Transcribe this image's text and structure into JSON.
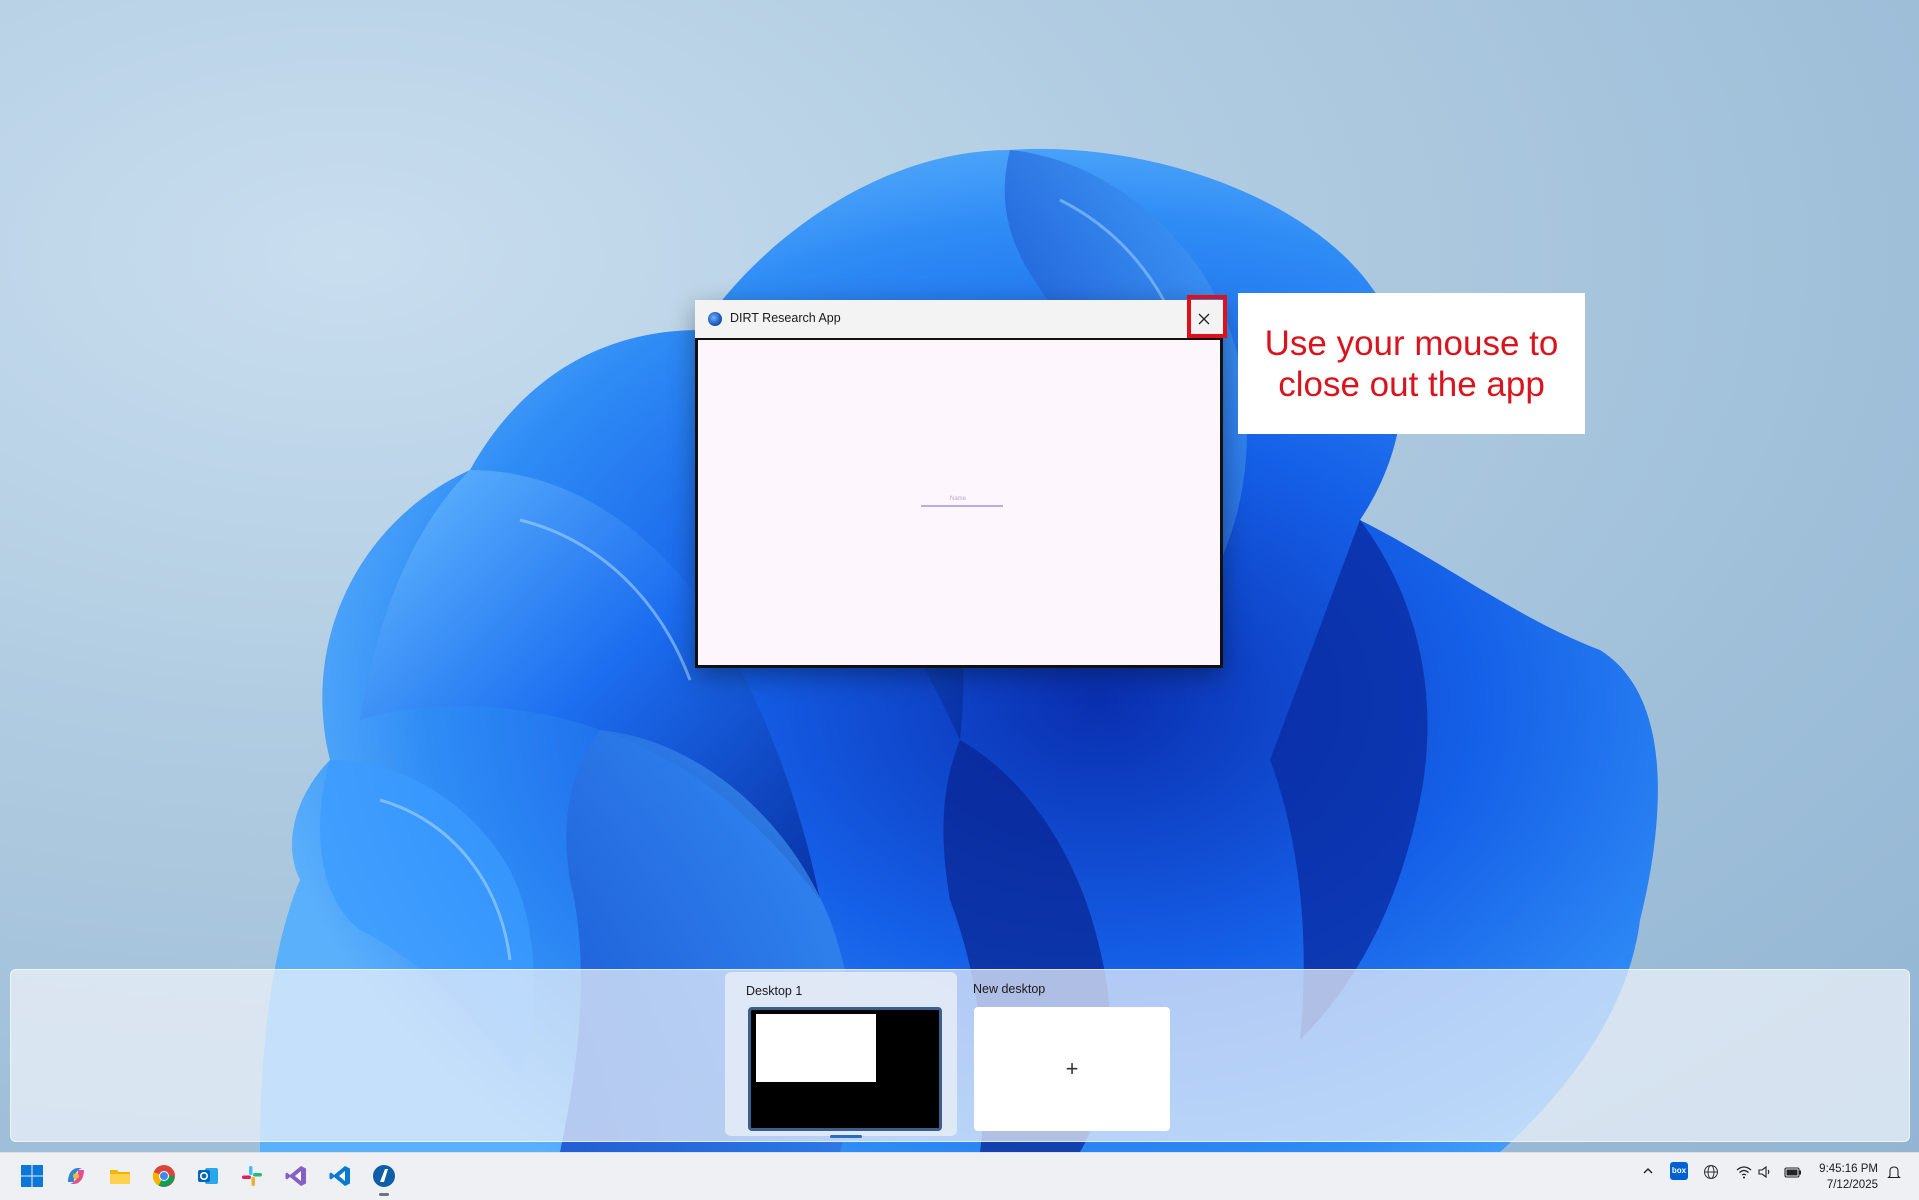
{
  "app": {
    "title": "DIRT Research App",
    "body_label": "Name"
  },
  "instruction": {
    "text": "Use your mouse to\nclose out the app"
  },
  "task_view": {
    "desktops": [
      {
        "label": "Desktop 1"
      },
      {
        "label": "New desktop",
        "plus": "+"
      }
    ]
  },
  "taskbar": {
    "apps": [
      "start-icon",
      "copilot-icon",
      "file-explorer-icon",
      "chrome-icon",
      "outlook-icon",
      "slack-icon",
      "visual-studio-icon",
      "vscode-icon",
      "dirt-app-icon"
    ],
    "tray": [
      "chevron-up-icon",
      "box-icon",
      "network-globe-icon",
      "wifi-icon",
      "volume-icon",
      "battery-icon",
      "notification-icon"
    ],
    "box_label": "box",
    "time": "9:45:16 PM",
    "date": "7/12/2025"
  },
  "colors": {
    "highlight": "#e0101a",
    "instruction_text": "#d9141c",
    "app_body": "#fdf6fd"
  }
}
